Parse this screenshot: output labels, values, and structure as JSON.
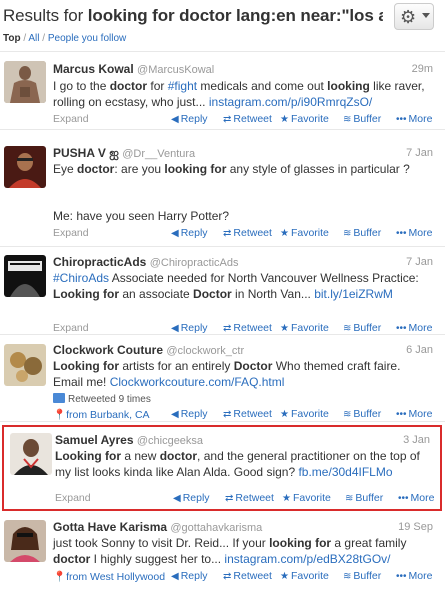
{
  "header": {
    "title_prefix": "Results for ",
    "title_query": "looking for doctor lang:en near:\"los an...",
    "gear_label": "⚙"
  },
  "filters": {
    "top": "Top",
    "sep1": " / ",
    "all": "All",
    "sep2": " / ",
    "people": "People you follow"
  },
  "actions": {
    "expand": "Expand",
    "reply": "Reply",
    "retweet": "Retweet",
    "favorite": "Favorite",
    "buffer": "Buffer",
    "more": "More"
  },
  "tweets": [
    {
      "name": "Marcus Kowal",
      "handle": "@MarcusKowal",
      "time": "29m",
      "text": [
        "I go to the ",
        "doctor",
        " for ",
        "#fight",
        " medicals and come out ",
        "looking",
        " like raver, rolling on ecstasy, who just... ",
        "instagram.com/p/i90RmrqZsO/"
      ]
    },
    {
      "name": "PUSHA V ஐ",
      "handle": "@Dr__Ventura",
      "time": "7 Jan",
      "text_l1": [
        "Eye ",
        "doctor",
        ": are you ",
        "looking for",
        " any style of glasses in particular ?"
      ],
      "text_l2": "Me: have you seen Harry Potter?"
    },
    {
      "name": "ChiropracticAds",
      "handle": "@ChiropracticAds",
      "time": "7 Jan",
      "text": [
        "#ChiroAds",
        " Associate needed for North Vancouver Wellness Practice: ",
        "Looking for",
        " an associate ",
        "Doctor",
        " in North Van... ",
        "bit.ly/1eiZRwM"
      ]
    },
    {
      "name": "Clockwork Couture",
      "handle": "@clockwork_ctr",
      "time": "6 Jan",
      "text": [
        "Looking for",
        " artists for an entirely ",
        "Doctor",
        " Who themed craft faire. Email me! ",
        "Clockworkcouture.com/FAQ.html"
      ],
      "retweeted": "Retweeted 9 times",
      "location": "from Burbank, CA"
    },
    {
      "name": "Samuel Ayres",
      "handle": "@chicgeeksa",
      "time": "3 Jan",
      "text": [
        "Looking for",
        " a new ",
        "doctor",
        ", and the general practitioner on the top of my list looks kinda like Alan Alda. Good sign? ",
        "fb.me/30d4IFLMo"
      ]
    },
    {
      "name": "Gotta Have Karisma",
      "handle": "@gottahavkarisma",
      "time": "19 Sep",
      "text": [
        "just took Sonny to visit Dr. Reid... If your ",
        "looking for",
        " a great family ",
        "doctor",
        " I highly suggest her to... ",
        "instagram.com/p/edBX28tGOv/"
      ],
      "location": "from West Hollywood"
    }
  ],
  "colors": {
    "link": "#2a6dbd",
    "highlight_border": "#d92b2b"
  }
}
